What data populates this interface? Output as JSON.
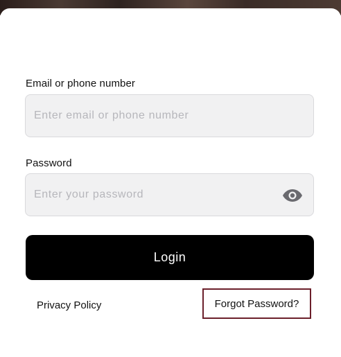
{
  "email": {
    "label": "Email or phone number",
    "placeholder": "Enter email or phone number",
    "value": ""
  },
  "password": {
    "label": "Password",
    "placeholder": "Enter your password",
    "value": "",
    "toggle_icon": "eye-icon"
  },
  "actions": {
    "login_label": "Login"
  },
  "links": {
    "privacy_policy": "Privacy Policy",
    "forgot_password": "Forgot Password?"
  },
  "colors": {
    "button_bg": "#000000",
    "highlight_border": "#6b1f2a",
    "input_bg": "#f1f1f2"
  }
}
